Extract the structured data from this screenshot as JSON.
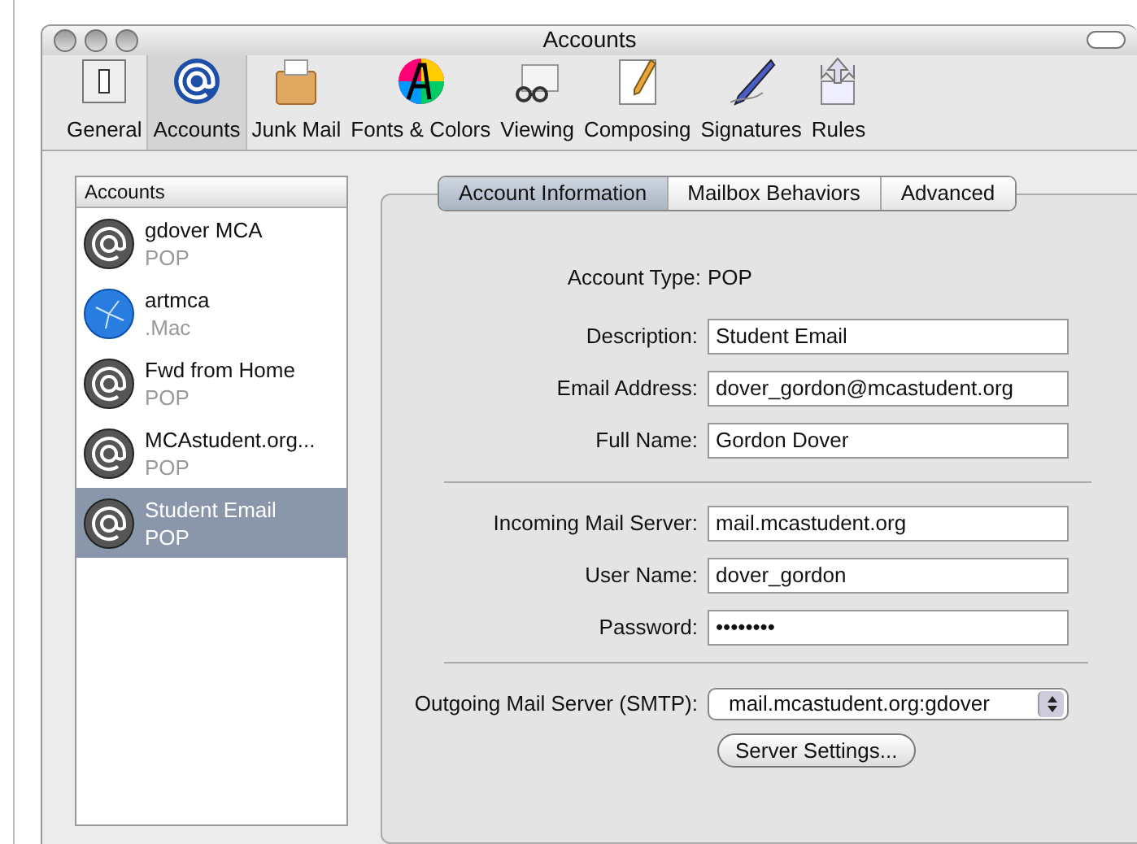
{
  "window": {
    "title": "Accounts"
  },
  "toolbar": [
    {
      "label": "General",
      "selected": false
    },
    {
      "label": "Accounts",
      "selected": true
    },
    {
      "label": "Junk Mail",
      "selected": false
    },
    {
      "label": "Fonts & Colors",
      "selected": false
    },
    {
      "label": "Viewing",
      "selected": false
    },
    {
      "label": "Composing",
      "selected": false
    },
    {
      "label": "Signatures",
      "selected": false
    },
    {
      "label": "Rules",
      "selected": false
    }
  ],
  "accounts": {
    "header": "Accounts",
    "items": [
      {
        "name": "gdover MCA",
        "type": "POP",
        "kind": "pop",
        "selected": false
      },
      {
        "name": "artmca",
        "type": ".Mac",
        "kind": "mac",
        "selected": false
      },
      {
        "name": "Fwd from Home",
        "type": "POP",
        "kind": "pop",
        "selected": false
      },
      {
        "name": "MCAstudent.org...",
        "type": "POP",
        "kind": "pop",
        "selected": false
      },
      {
        "name": "Student Email",
        "type": "POP",
        "kind": "pop",
        "selected": true
      }
    ]
  },
  "tabs": [
    {
      "label": "Account Information",
      "selected": true
    },
    {
      "label": "Mailbox Behaviors",
      "selected": false
    },
    {
      "label": "Advanced",
      "selected": false
    }
  ],
  "account_type": {
    "label": "Account Type:",
    "value": "POP"
  },
  "field_groups": [
    [
      {
        "label": "Description:",
        "value": "Student Email"
      },
      {
        "label": "Email Address:",
        "value": "dover_gordon@mcastudent.org"
      },
      {
        "label": "Full Name:",
        "value": "Gordon Dover"
      }
    ],
    [
      {
        "label": "Incoming Mail Server:",
        "value": "mail.mcastudent.org"
      },
      {
        "label": "User Name:",
        "value": "dover_gordon"
      },
      {
        "label": "Password:",
        "value": "••••••••"
      }
    ]
  ],
  "outgoing": {
    "label": "Outgoing Mail Server (SMTP):",
    "value": "mail.mcastudent.org:gdover"
  },
  "server_settings_button": "Server Settings..."
}
